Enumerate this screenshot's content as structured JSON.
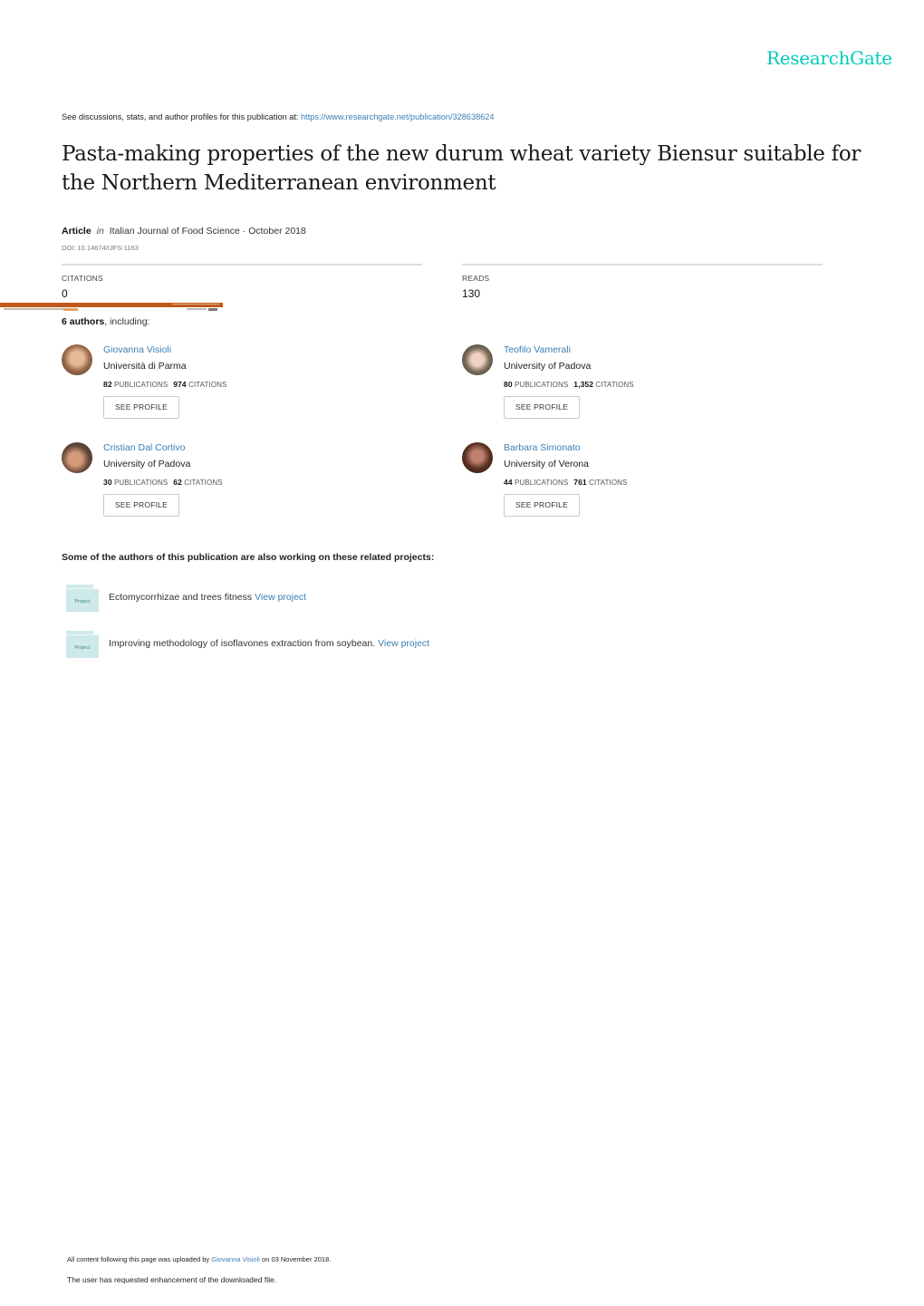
{
  "brand": {
    "logo_text": "ResearchGate",
    "accent_color": "#00ccbb",
    "link_color": "#3b7fb5"
  },
  "header": {
    "see_discussions_prefix": "See discussions, stats, and author profiles for this publication at: ",
    "publication_url": "https://www.researchgate.net/publication/328638624"
  },
  "publication": {
    "title": "Pasta-making properties of the new durum wheat variety Biensur suitable for the Northern Mediterranean environment",
    "type": "Article",
    "in_label": "in",
    "journal_date": "Italian Journal of Food Science · October 2018",
    "doi": "DOI: 10.14674/IJFS-1163"
  },
  "stats": {
    "citations_label": "CITATIONS",
    "citations_value": "0",
    "reads_label": "READS",
    "reads_value": "130"
  },
  "authors_section": {
    "count_label": "6 authors",
    "suffix": ", including:",
    "publications_label": "PUBLICATIONS",
    "citations_label": "CITATIONS",
    "button_label": "SEE PROFILE",
    "authors": [
      {
        "name": "Giovanna Visioli",
        "institution": "Università di Parma",
        "publications": "82",
        "citations": "974"
      },
      {
        "name": "Teofilo Vamerali",
        "institution": "University of Padova",
        "publications": "80",
        "citations": "1,352"
      },
      {
        "name": "Cristian Dal Cortivo",
        "institution": "University of Padova",
        "publications": "30",
        "citations": "62"
      },
      {
        "name": "Barbara Simonato",
        "institution": "University of Verona",
        "publications": "44",
        "citations": "761"
      }
    ]
  },
  "related": {
    "heading": "Some of the authors of this publication are also working on these related projects:",
    "folder_label": "Project",
    "link_label": "View project",
    "projects": [
      {
        "title": "Ectomycorrhizae and trees fitness "
      },
      {
        "title": "Improving methodology of isoflavones extraction from soybean. "
      }
    ]
  },
  "footer": {
    "uploaded_prefix": "All content following this page was uploaded by ",
    "uploader": "Giovanna Visioli",
    "uploaded_suffix": " on 03 November 2018.",
    "enhancement_note": "The user has requested enhancement of the downloaded file."
  }
}
